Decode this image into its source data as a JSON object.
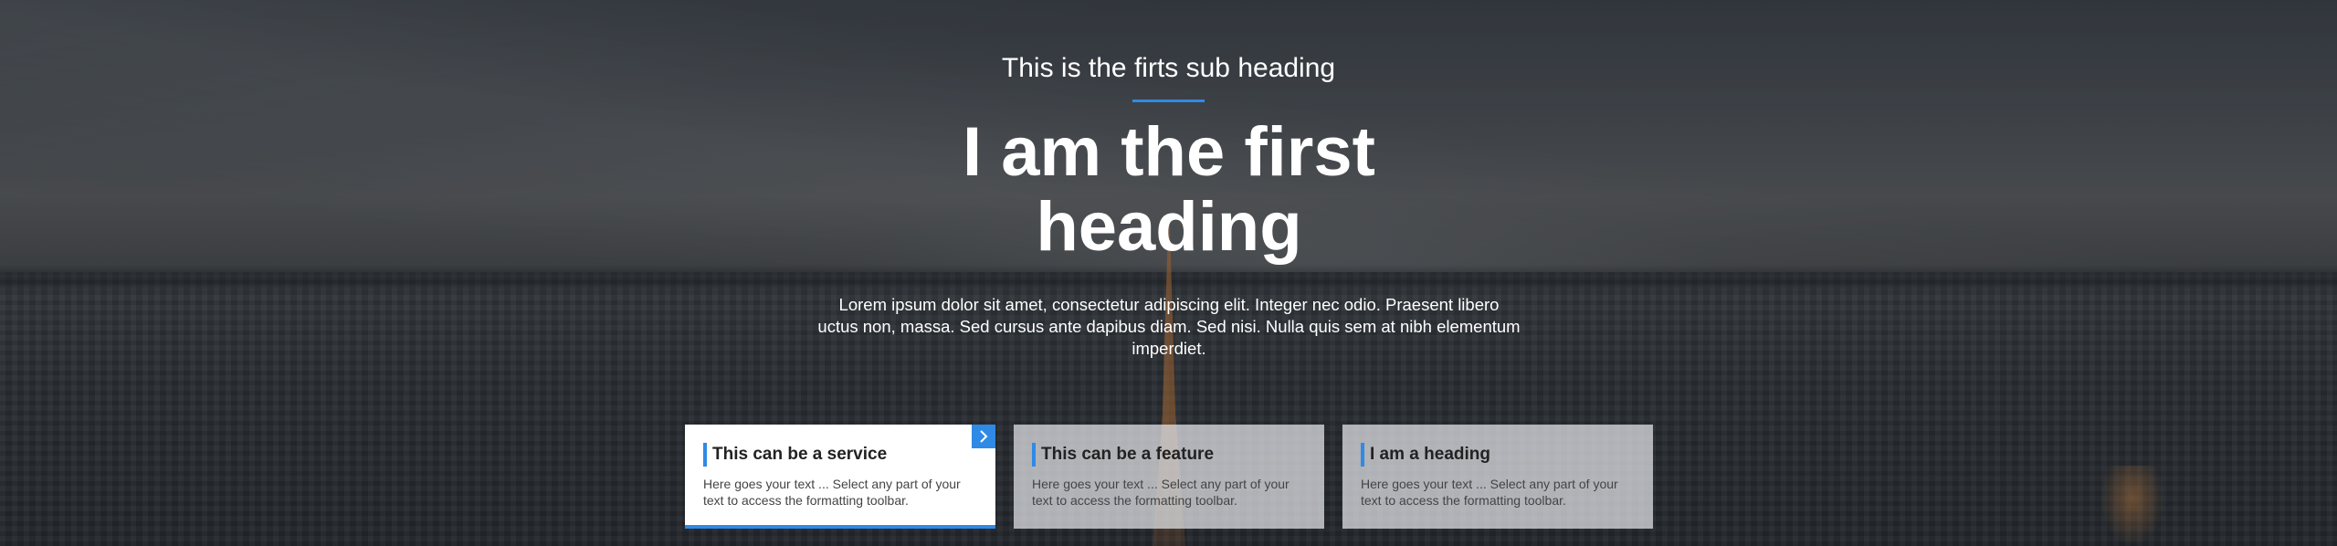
{
  "hero": {
    "sub_heading": "This is the firts sub heading",
    "heading": "I am the first heading",
    "body": "Lorem ipsum dolor sit amet, consectetur adipiscing elit. Integer nec odio. Praesent libero uctus non, massa. Sed cursus ante dapibus diam. Sed nisi. Nulla quis sem at nibh elementum imperdiet."
  },
  "cards": [
    {
      "title": "This can be a service",
      "text": "Here goes your text ... Select any part of your text to access the formatting toolbar.",
      "icon": "chevron-right-icon",
      "active": true
    },
    {
      "title": "This can be a feature",
      "text": "Here goes your text ... Select any part of your text to access the formatting toolbar.",
      "active": false
    },
    {
      "title": "I am a heading",
      "text": "Here goes your text ... Select any part of your text to access the formatting toolbar.",
      "active": false
    }
  ],
  "colors": {
    "accent": "#2f8ae6",
    "text_light": "#ffffff",
    "card_title": "#222222",
    "card_text": "#444444"
  }
}
